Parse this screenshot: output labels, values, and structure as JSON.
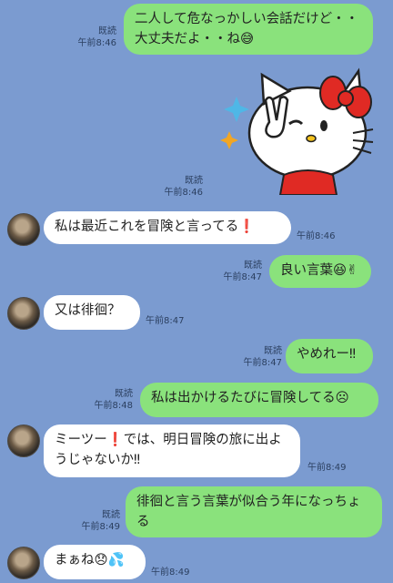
{
  "messages": [
    {
      "side": "sent",
      "text": "二人して危なっかしい会話だけど・・大丈夫だよ・・ね😅",
      "read": "既読",
      "time": "午前8:46"
    },
    {
      "side": "sent-sticker",
      "read": "既読",
      "time": "午前8:46",
      "sticker": "hello-kitty-wink"
    },
    {
      "side": "recv",
      "text": "私は最近これを冒険と言ってる❗",
      "time": "午前8:46"
    },
    {
      "side": "sent",
      "text": "良い言葉😆✌",
      "read": "既読",
      "time": "午前8:47"
    },
    {
      "side": "recv",
      "text": "又は徘徊？",
      "time": "午前8:47"
    },
    {
      "side": "sent",
      "text": "やめれー‼",
      "read": "既読",
      "time": "午前8:47"
    },
    {
      "side": "sent",
      "text": "私は出かけるたびに冒険してる☹",
      "read": "既読",
      "time": "午前8:48"
    },
    {
      "side": "recv",
      "text": "ミーツー❗では、明日冒険の旅に出ようじゃないか‼",
      "time": "午前8:49"
    },
    {
      "side": "sent",
      "text": "徘徊と言う言葉が似合う年になっちょる",
      "read": "既読",
      "time": "午前8:49"
    },
    {
      "side": "recv",
      "text": "まぁね😞💦",
      "time": "午前8:49"
    }
  ]
}
